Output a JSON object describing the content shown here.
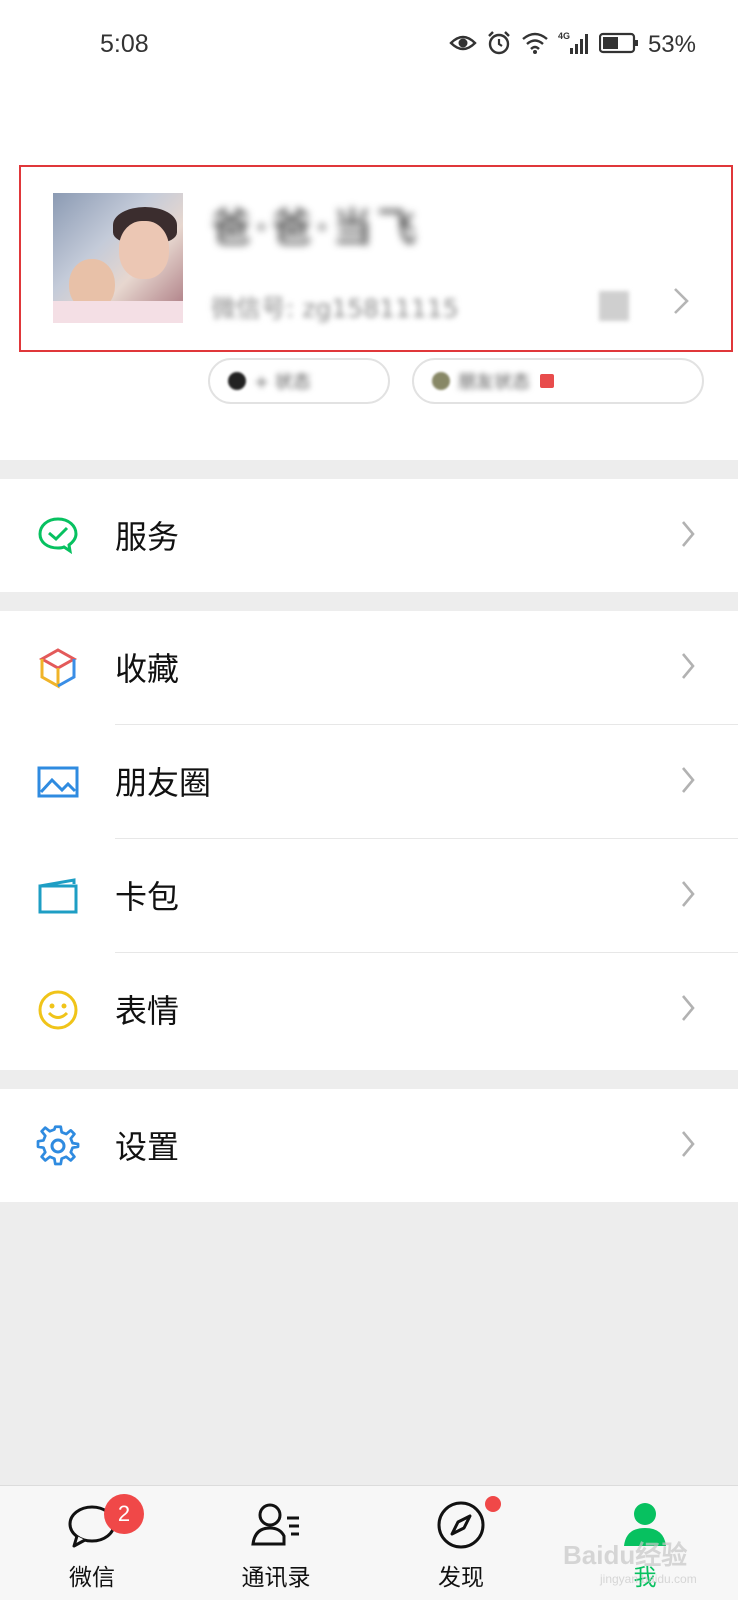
{
  "status_bar": {
    "time": "5:08",
    "network": "4G",
    "battery_percent": "53%",
    "battery_level": 0.53
  },
  "profile": {
    "nickname": "爸·爸·当飞",
    "wechat_id": "微信号: zg15811115",
    "status_pill": "+ 状态",
    "friends_pill": "朋友状态"
  },
  "menu": {
    "services": {
      "label": "服务",
      "icon": "wechat-pay-check-icon"
    },
    "favorites": {
      "label": "收藏",
      "icon": "cube-icon"
    },
    "moments": {
      "label": "朋友圈",
      "icon": "image-icon"
    },
    "cards": {
      "label": "卡包",
      "icon": "wallet-icon"
    },
    "stickers": {
      "label": "表情",
      "icon": "smiley-icon"
    },
    "settings": {
      "label": "设置",
      "icon": "gear-icon"
    }
  },
  "tabbar": {
    "chats": {
      "label": "微信",
      "badge": "2"
    },
    "contacts": {
      "label": "通讯录"
    },
    "discover": {
      "label": "发现"
    },
    "me": {
      "label": "我"
    }
  },
  "watermark": {
    "text": "Baidu经验",
    "sub": "jingyan.baidu.com"
  },
  "colors": {
    "brand_green": "#07c160",
    "highlight_border": "#e0373a",
    "badge_red": "#f04848"
  }
}
